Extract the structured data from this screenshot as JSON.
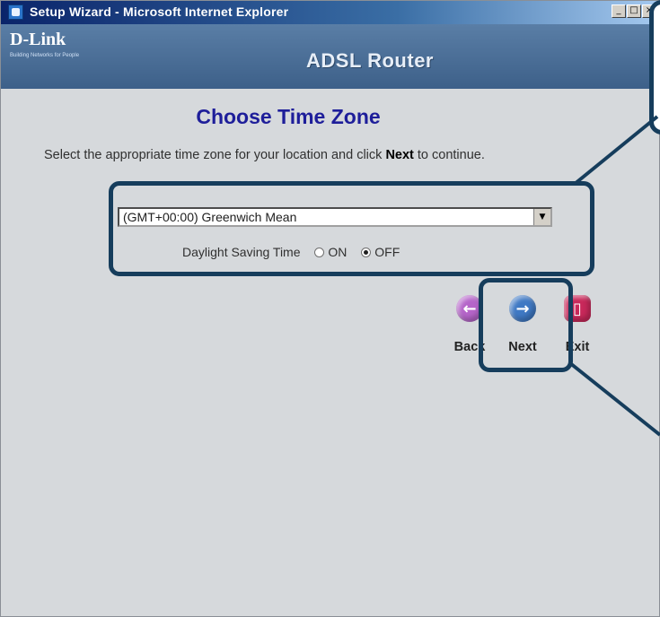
{
  "window": {
    "title": "Setup Wizard - Microsoft Internet Explorer",
    "controls": [
      "_",
      "□",
      "×"
    ]
  },
  "header": {
    "logo": "D-Link",
    "tagline": "Building Networks for People",
    "product": "ADSL Router"
  },
  "main": {
    "heading": "Choose Time Zone",
    "instruction_pre": "Select the appropriate time zone for your location and click ",
    "instruction_bold": "Next",
    "instruction_post": " to continue.",
    "timezone_select": {
      "selected": "(GMT+00:00) Greenwich Mean"
    },
    "daylight_saving": {
      "label": "Daylight Saving Time",
      "options": [
        "ON",
        "OFF"
      ],
      "selected": "OFF"
    }
  },
  "navigation": {
    "back_label": "Back",
    "next_label": "Next",
    "exit_label": "Exit"
  },
  "colors": {
    "heading": "#1e1e9a",
    "header_bar": "#4a6e97",
    "callout_border": "#163d5c",
    "back_button": "#b565c9",
    "next_button": "#3f79c4",
    "exit_button": "#c8285a"
  },
  "icons": {
    "back": "arrow-left-icon",
    "next": "arrow-right-icon",
    "exit": "exit-door-icon"
  }
}
